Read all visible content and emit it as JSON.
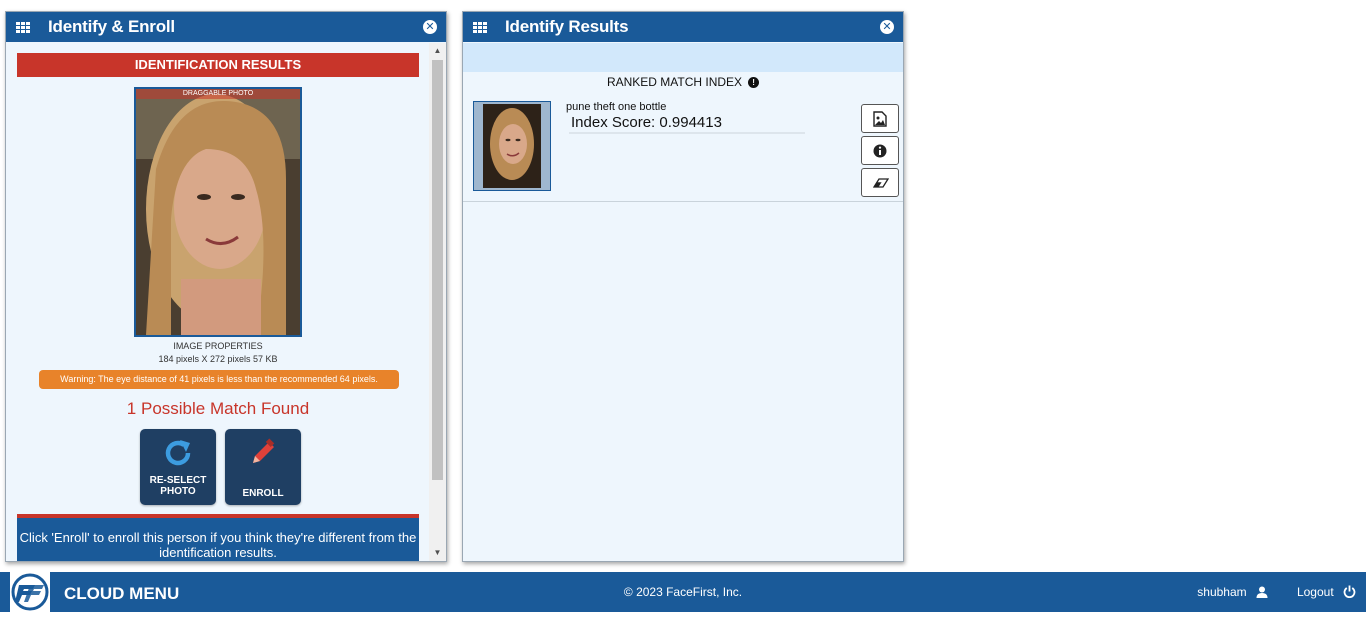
{
  "left_panel": {
    "title": "Identify & Enroll",
    "results_header": "IDENTIFICATION RESULTS",
    "photo_label": "DRAGGABLE PHOTO",
    "image_properties_title": "IMAGE PROPERTIES",
    "image_properties_value": "184 pixels X 272 pixels 57 KB",
    "warning": "Warning: The eye distance of 41 pixels is less than the recommended 64 pixels.",
    "match_found": "1 Possible Match Found",
    "reselect_label_1": "RE-SELECT",
    "reselect_label_2": "PHOTO",
    "enroll_label": "ENROLL",
    "enroll_note": "Click 'Enroll' to enroll this person if you think they're different from the identification results."
  },
  "right_panel": {
    "title": "Identify Results",
    "ranked_title": "RANKED MATCH INDEX",
    "match": {
      "name": "pune theft one bottle",
      "score": "Index Score: 0.994413"
    }
  },
  "footer": {
    "menu": "CLOUD MENU",
    "copyright": "© 2023 FaceFirst, Inc.",
    "user": "shubham",
    "logout": "Logout"
  },
  "colors": {
    "header_blue": "#1a5a99",
    "alert_red": "#c8352a",
    "warning_orange": "#e8832a",
    "button_dark": "#1f3f63"
  },
  "icons": [
    "grid-icon",
    "close-icon",
    "refresh-icon",
    "pencil-icon",
    "info-icon",
    "image-icon",
    "eraser-icon",
    "user-icon",
    "power-icon"
  ]
}
